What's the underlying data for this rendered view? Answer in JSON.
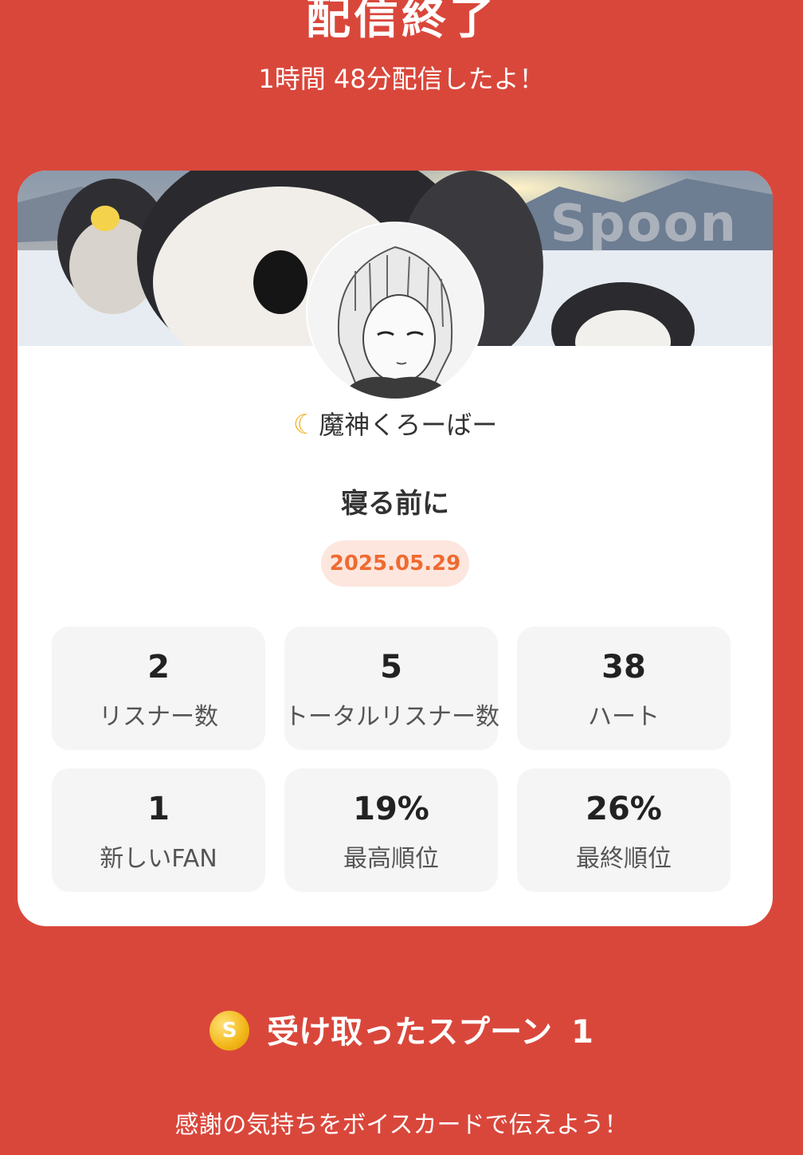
{
  "header": {
    "title": "配信終了",
    "subtitle": "1時間 48分配信したよ！"
  },
  "card": {
    "banner_watermark": "Spoon",
    "banner_image": "penguin-chicks-snow-mountains",
    "avatar_image": "manga-style-character-portrait",
    "username": "魔神くろーばー",
    "username_icon": "crescent-moon-icon",
    "stream_title": "寝る前に",
    "date": "2025.05.29"
  },
  "stats": [
    {
      "value": "2",
      "label": "リスナー数"
    },
    {
      "value": "5",
      "label": "トータルリスナー数"
    },
    {
      "value": "38",
      "label": "ハート"
    },
    {
      "value": "1",
      "label": "新しいFAN"
    },
    {
      "value": "19%",
      "label": "最高順位"
    },
    {
      "value": "26%",
      "label": "最終順位"
    }
  ],
  "spoon": {
    "coin_letter": "S",
    "label": "受け取ったスプーン",
    "count": "1"
  },
  "footer": {
    "message": "感謝の気持ちをボイスカードで伝えよう！"
  },
  "colors": {
    "background": "#d9473b",
    "card": "#ffffff",
    "date_badge_bg": "#fde6de",
    "date_badge_text": "#f06a30",
    "stat_bg": "#f5f5f5",
    "coin": "#f2b617"
  }
}
